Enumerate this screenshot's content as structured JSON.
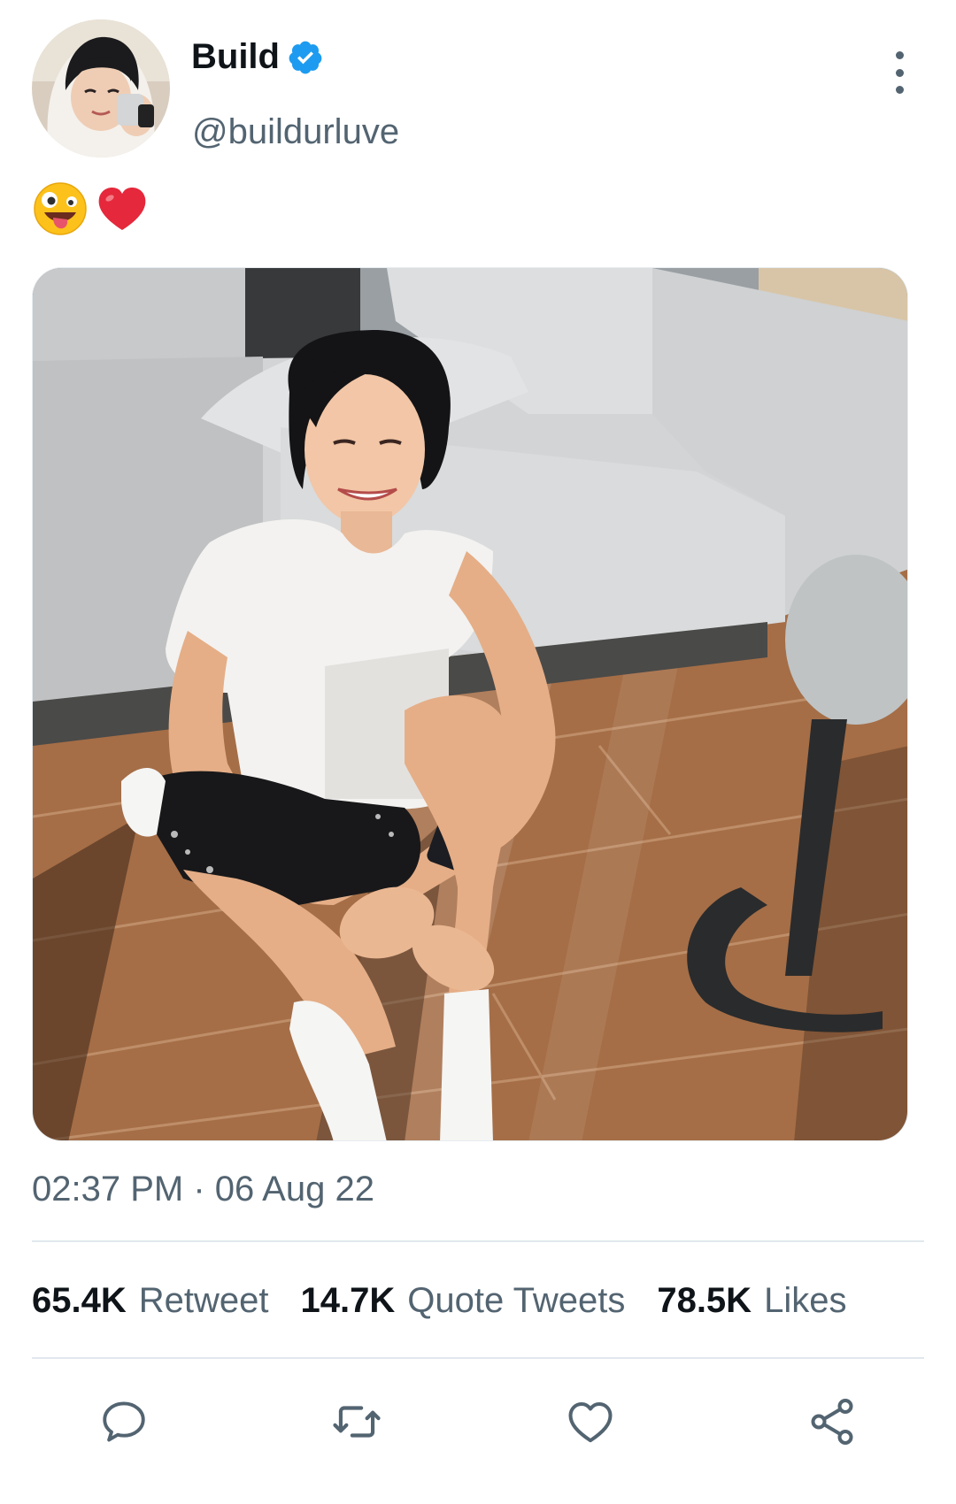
{
  "tweet": {
    "author": {
      "display_name": "Build",
      "handle": "@buildurluve",
      "verified": true,
      "avatar_icon": "profile-photo"
    },
    "text_emojis": [
      "zany-face-emoji",
      "red-heart-emoji"
    ],
    "timestamp": "02:37 PM · 06 Aug 22",
    "stats": {
      "retweets_count": "65.4K",
      "retweets_label": "Retweet",
      "quotes_count": "14.7K",
      "quotes_label": "Quote Tweets",
      "likes_count": "78.5K",
      "likes_label": "Likes"
    },
    "actions": [
      "reply-icon",
      "retweet-icon",
      "like-icon",
      "share-icon"
    ]
  },
  "colors": {
    "verified_blue": "#1d9bf0",
    "secondary_text": "#536471",
    "primary_text": "#0f1419",
    "divider": "#e1e8ed"
  }
}
